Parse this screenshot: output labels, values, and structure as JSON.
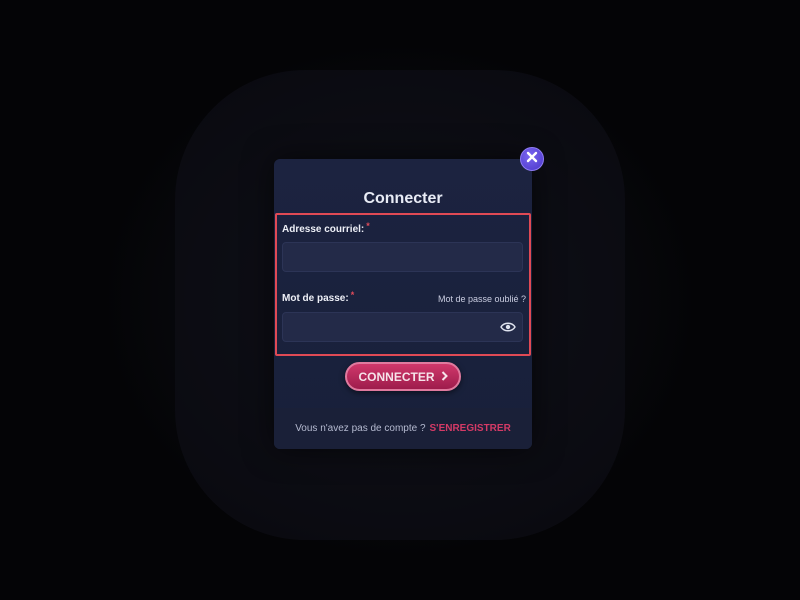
{
  "modal": {
    "title": "Connecter",
    "close_icon": "close-icon"
  },
  "form": {
    "email_label": "Adresse courriel:",
    "email_required": "*",
    "email_value": "",
    "password_label": "Mot de passe:",
    "password_required": "*",
    "password_value": "",
    "forgot_link": "Mot de passe oublié ?",
    "eye_icon": "eye-icon"
  },
  "actions": {
    "connect_label": "CONNECTER",
    "connect_icon": "chevron-right-icon"
  },
  "footer": {
    "question": "Vous n'avez pas de compte ?",
    "register_link": "S'ENREGISTRER"
  },
  "colors": {
    "accent": "#d0386b",
    "highlight_border": "#e04a55",
    "close_button": "#5a44d8"
  }
}
